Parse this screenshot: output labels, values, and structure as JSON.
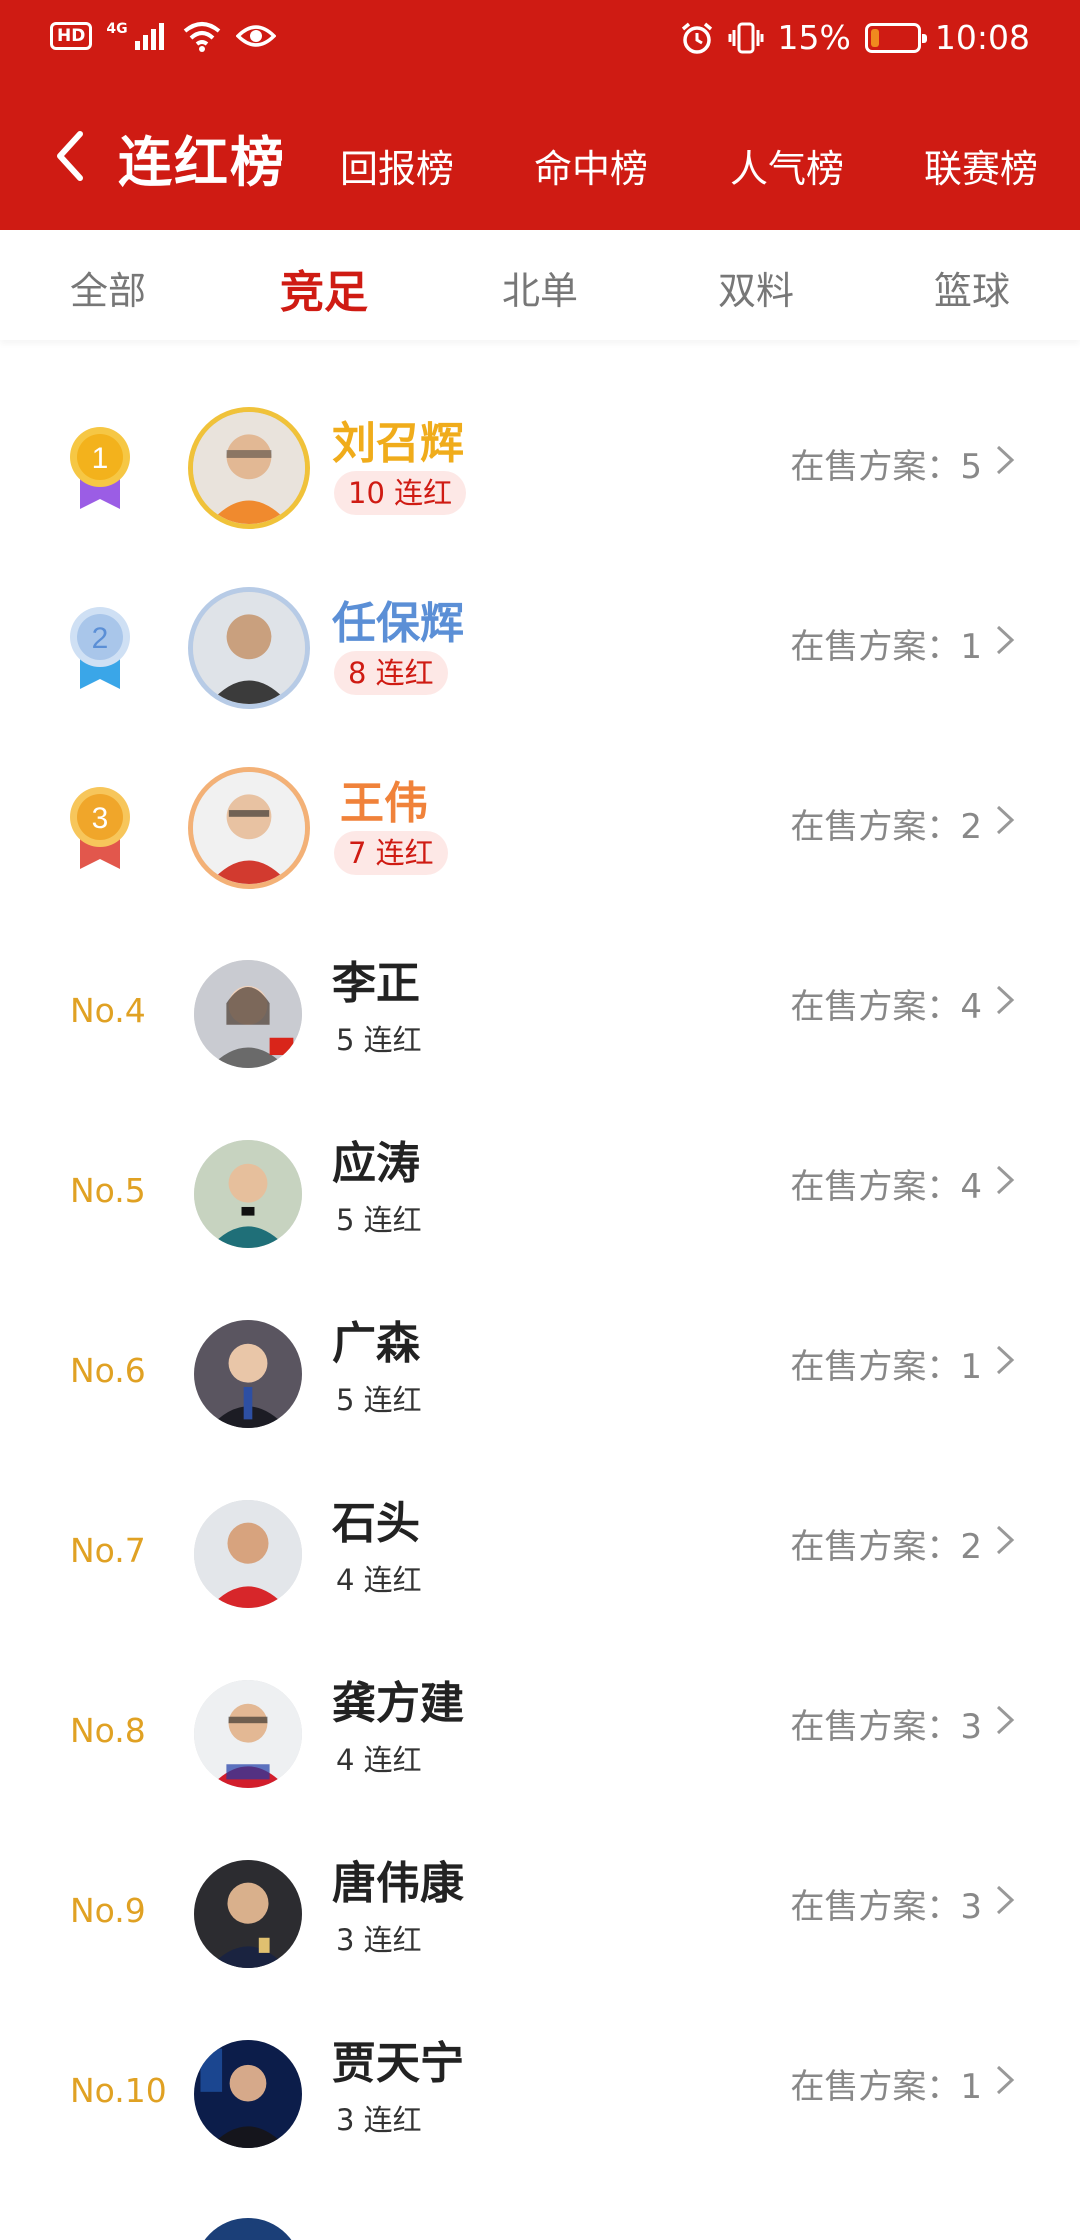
{
  "status_bar": {
    "hd": "HD",
    "network": "4G",
    "battery_percent_text": "15%",
    "battery_level": 0.15,
    "time": "10:08"
  },
  "nav": {
    "title": "连红榜",
    "tabs": [
      "回报榜",
      "命中榜",
      "人气榜",
      "联赛榜"
    ]
  },
  "categories": {
    "items": [
      "全部",
      "竞足",
      "北单",
      "双料",
      "篮球"
    ],
    "active": "竞足"
  },
  "colors": {
    "brand_red": "#cf1b13",
    "gold": "#f0ac1b",
    "silver_blue": "#5b8fd6",
    "bronze_orange": "#f0823a",
    "rank_text": "#e0a123"
  },
  "on_sale_label": "在售方案：",
  "list": [
    {
      "rank": "1",
      "name": "刘召辉",
      "streak": "10 连红",
      "on_sale": "5",
      "medal": "gold"
    },
    {
      "rank": "2",
      "name": "任保辉",
      "streak": "8 连红",
      "on_sale": "1",
      "medal": "silver"
    },
    {
      "rank": "3",
      "name": "王伟",
      "streak": "7 连红",
      "on_sale": "2",
      "medal": "bronze"
    },
    {
      "rank": "No.4",
      "name": "李正",
      "streak": "5 连红",
      "on_sale": "4"
    },
    {
      "rank": "No.5",
      "name": "应涛",
      "streak": "5 连红",
      "on_sale": "4"
    },
    {
      "rank": "No.6",
      "name": "广森",
      "streak": "5 连红",
      "on_sale": "1"
    },
    {
      "rank": "No.7",
      "name": "石头",
      "streak": "4 连红",
      "on_sale": "2"
    },
    {
      "rank": "No.8",
      "name": "龚方建",
      "streak": "4 连红",
      "on_sale": "3"
    },
    {
      "rank": "No.9",
      "name": "唐伟康",
      "streak": "3 连红",
      "on_sale": "3"
    },
    {
      "rank": "No.10",
      "name": "贾天宁",
      "streak": "3 连红",
      "on_sale": "1"
    }
  ]
}
